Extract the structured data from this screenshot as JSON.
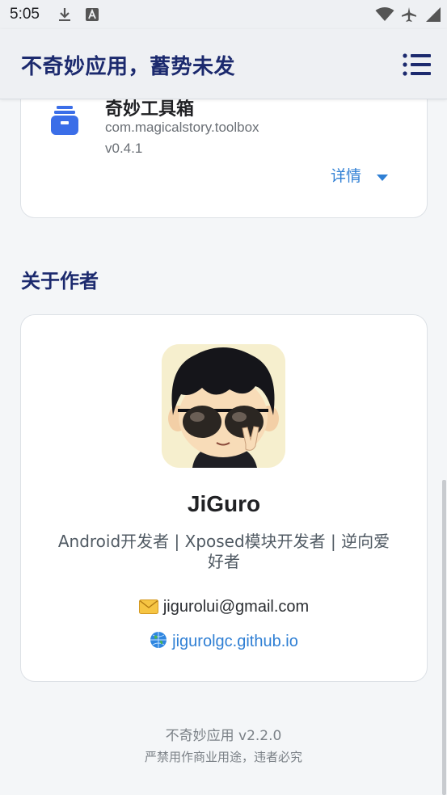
{
  "status_bar": {
    "time": "5:05"
  },
  "app_bar": {
    "title": "不奇妙应用，蓄势未发",
    "menu_icon": "list-menu-icon"
  },
  "app_card": {
    "name": "奇妙工具箱",
    "package": "com.magicalstory.toolbox",
    "version": "v0.4.1",
    "details_label": "详情",
    "icon": "toolbox-icon",
    "icon_color": "#3b6ee8"
  },
  "about": {
    "section_title": "关于作者",
    "author_name": "JiGuro",
    "bio": "Android开发者 | Xposed模块开发者 | 逆向爱好者",
    "email": "jigurolui@gmail.com",
    "email_icon": "envelope-icon",
    "website": "jigurolgc.github.io",
    "website_icon": "globe-icon"
  },
  "footer": {
    "version": "不奇妙应用 v2.2.0",
    "notice": "严禁用作商业用途，违者必究"
  },
  "colors": {
    "accent": "#2f7fd4",
    "title": "#1c2a6e"
  }
}
